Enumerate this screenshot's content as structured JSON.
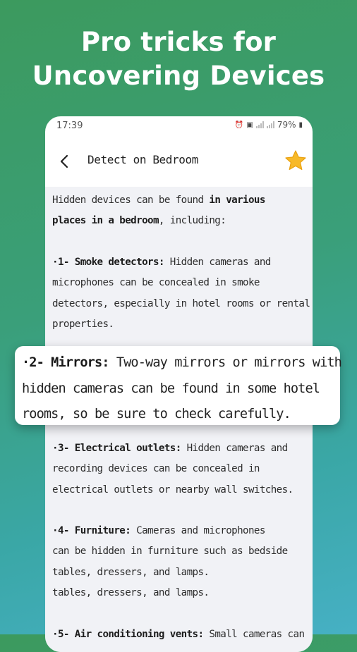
{
  "headline": {
    "line1": "Pro tricks for",
    "line2": "Uncovering Devices"
  },
  "status_bar": {
    "time": "17:39",
    "battery": "79%"
  },
  "app_bar": {
    "title": "Detect on Bedroom"
  },
  "intro": {
    "line1_pre": "Hidden devices can be found ",
    "line1_bold": "in various",
    "line2_bold": "places in a bedroom",
    "line2_post": ", including:"
  },
  "items": [
    {
      "title": "·1- Smoke detectors:",
      "first_line_rest": " Hidden cameras and",
      "lines": [
        "microphones can be concealed in smoke",
        "detectors, especially in hotel rooms or rental",
        "properties."
      ]
    },
    {
      "title": "·2- Mirrors:",
      "first_line_rest": " Two-way mirrors or mirrors with",
      "lines": [
        "hidden cameras can be found in some hotel",
        "rooms, so be sure to check carefully."
      ]
    },
    {
      "title": "·3- Electrical outlets:",
      "first_line_rest": " Hidden cameras and",
      "lines": [
        "recording devices can be concealed in",
        "electrical outlets or nearby wall switches."
      ]
    },
    {
      "title": "·4- Furniture:",
      "first_line_rest": " Cameras and microphones",
      "lines": [
        "can be hidden in furniture such as bedside",
        "tables, dressers, and lamps.",
        "tables, dressers, and lamps."
      ]
    },
    {
      "title": "·5- Air conditioning vents:",
      "first_line_rest": " Small cameras can"
    }
  ]
}
